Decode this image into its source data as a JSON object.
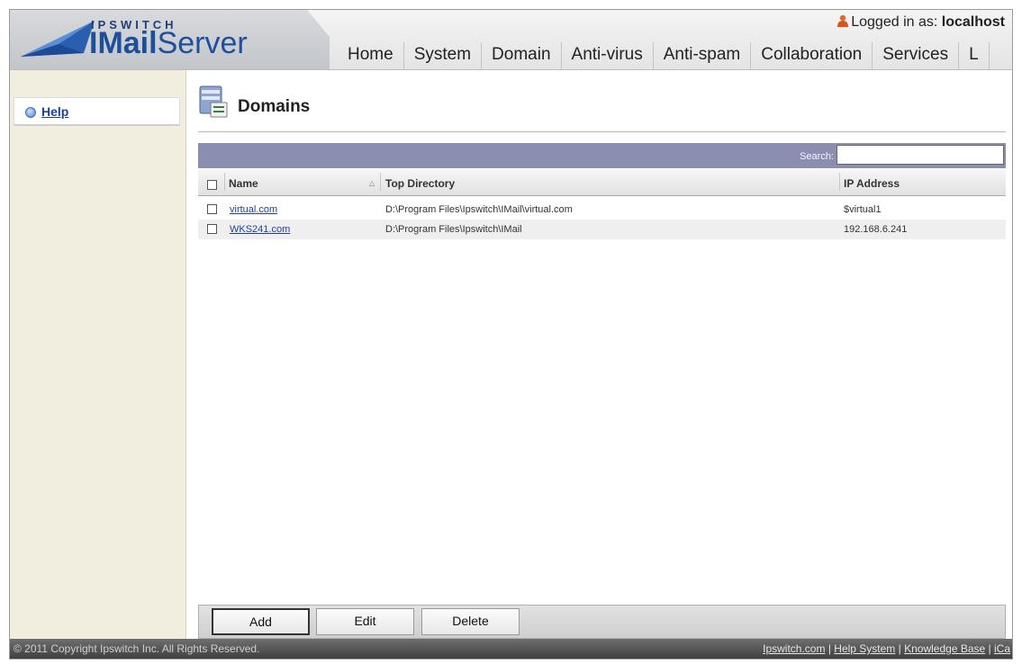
{
  "app": {
    "brand": "IPSWITCH",
    "product_light": "Server",
    "product_bold": "IMail"
  },
  "header": {
    "logged_in_prefix": "Logged in as:",
    "username": "localhost"
  },
  "nav": [
    "Home",
    "System",
    "Domain",
    "Anti-virus",
    "Anti-spam",
    "Collaboration",
    "Services",
    "L"
  ],
  "sidebar": {
    "help_label": "Help"
  },
  "page": {
    "title": "Domains"
  },
  "search": {
    "label": "Search:",
    "value": ""
  },
  "table": {
    "columns": [
      "Name",
      "Top Directory",
      "IP Address"
    ],
    "rows": [
      {
        "name": "virtual.com",
        "top_directory": "D:\\Program Files\\Ipswitch\\IMail\\virtual.com",
        "ip_address": "$virtual1"
      },
      {
        "name": "WKS241.com",
        "top_directory": "D:\\Program Files\\Ipswitch\\IMail",
        "ip_address": "192.168.6.241"
      }
    ]
  },
  "actions": {
    "add": "Add",
    "edit": "Edit",
    "delete": "Delete"
  },
  "footer": {
    "copyright": "© 2011 Copyright Ipswitch Inc. All Rights Reserved.",
    "links": [
      "Ipswitch.com",
      "Help System",
      "Knowledge Base",
      "iCa"
    ]
  },
  "icons": {
    "logo": "envelope-logo-icon",
    "user": "user-icon",
    "help": "help-icon",
    "page": "server-domain-icon",
    "sort": "sort-asc-icon"
  }
}
